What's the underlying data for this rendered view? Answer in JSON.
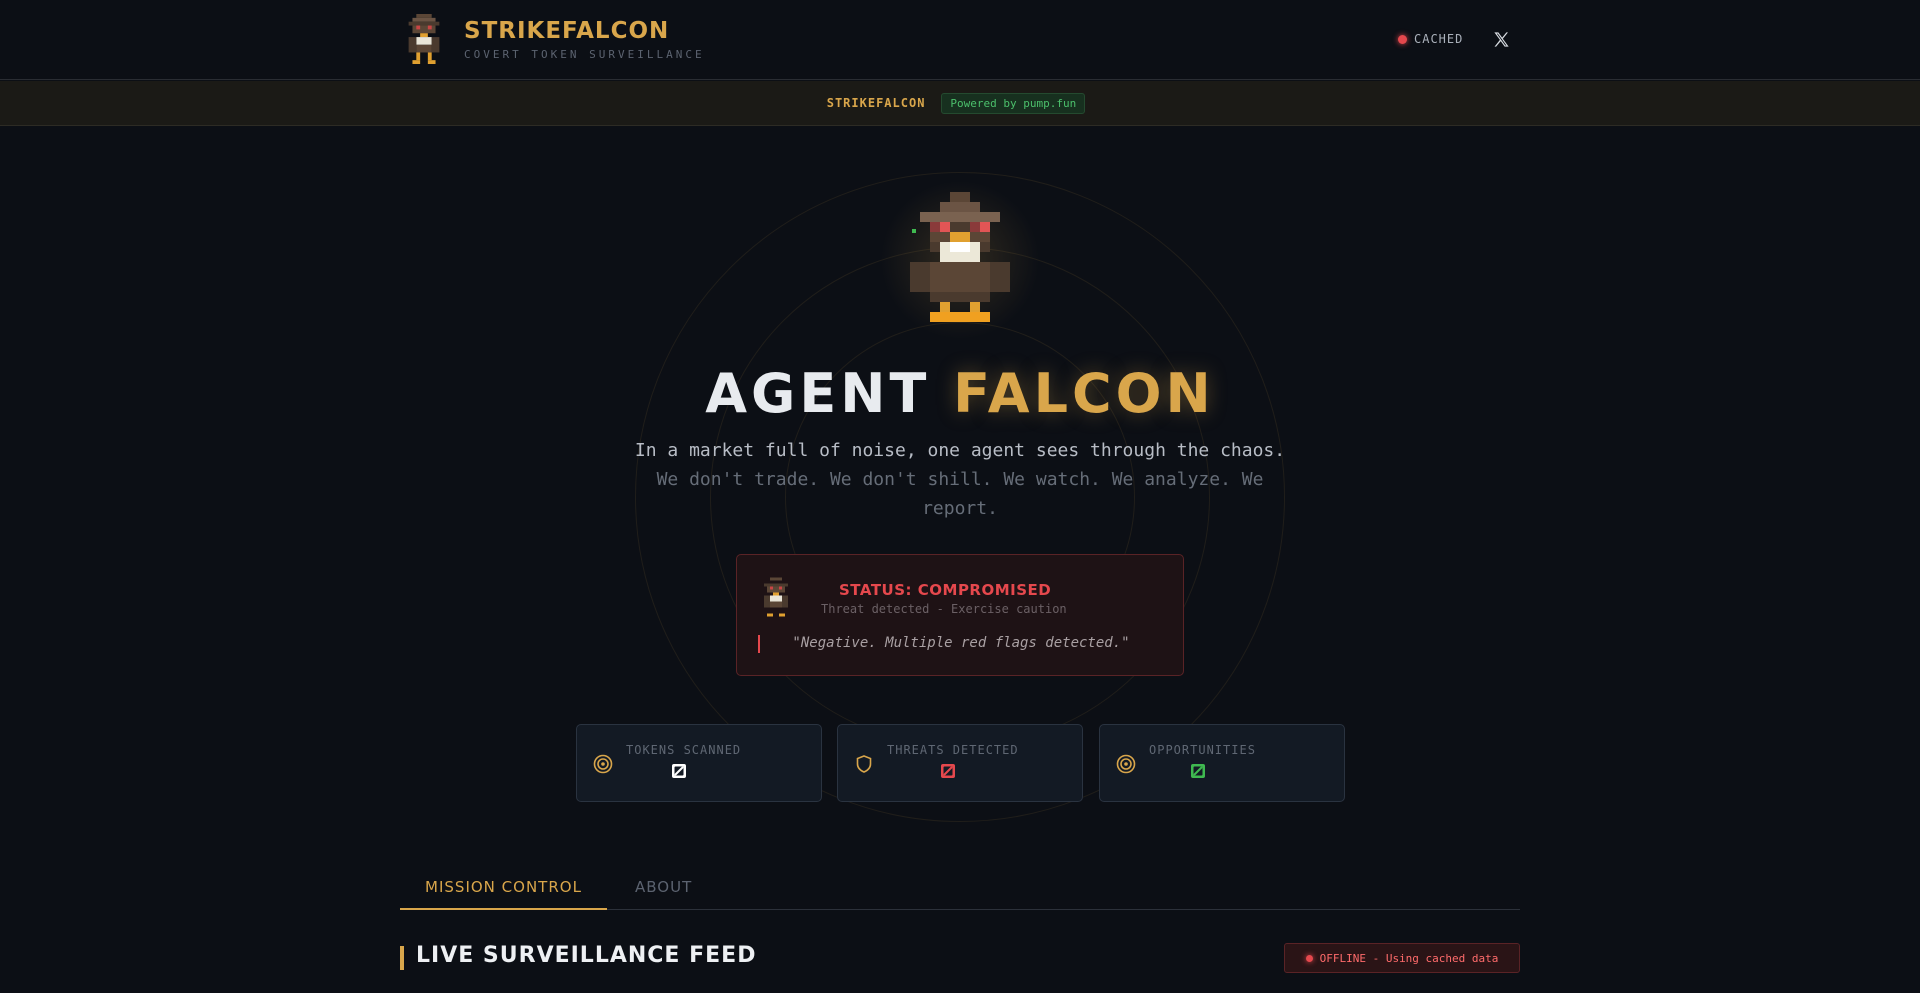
{
  "header": {
    "brand_title": "STRIKEFALCON",
    "brand_subtitle": "COVERT TOKEN SURVEILLANCE",
    "status_label": "CACHED",
    "x_icon": "x-logo-icon"
  },
  "ticker": {
    "name": "STRIKEFALCON",
    "powered_by": "Powered by pump.fun"
  },
  "hero": {
    "title_part1": "AGENT",
    "title_part2": "FALCON",
    "tagline_line1": "In a market full of noise, one agent sees through the chaos.",
    "tagline_line2": "We don't trade. We don't shill. We watch. We analyze. We report."
  },
  "status_card": {
    "heading": "STATUS: COMPROMISED",
    "subheading": "Threat detected - Exercise caution",
    "quote": "\"Negative. Multiple red flags detected.\""
  },
  "stats": [
    {
      "label": "TOKENS SCANNED",
      "icon": "target-icon",
      "value_icon": "broken-value-icon",
      "color": "#ffffff"
    },
    {
      "label": "THREATS DETECTED",
      "icon": "shield-icon",
      "value_icon": "broken-value-icon",
      "color": "#e5484d"
    },
    {
      "label": "OPPORTUNITIES",
      "icon": "target-icon",
      "value_icon": "broken-value-icon",
      "color": "#3fb950"
    }
  ],
  "tabs": [
    {
      "label": "MISSION CONTROL",
      "active": true
    },
    {
      "label": "ABOUT",
      "active": false
    }
  ],
  "feed": {
    "title": "LIVE SURVEILLANCE FEED",
    "status": "OFFLINE - Using cached data"
  },
  "colors": {
    "accent": "#d9a64b",
    "danger": "#e5484d",
    "success": "#3fb950",
    "background": "#0c0f15"
  }
}
